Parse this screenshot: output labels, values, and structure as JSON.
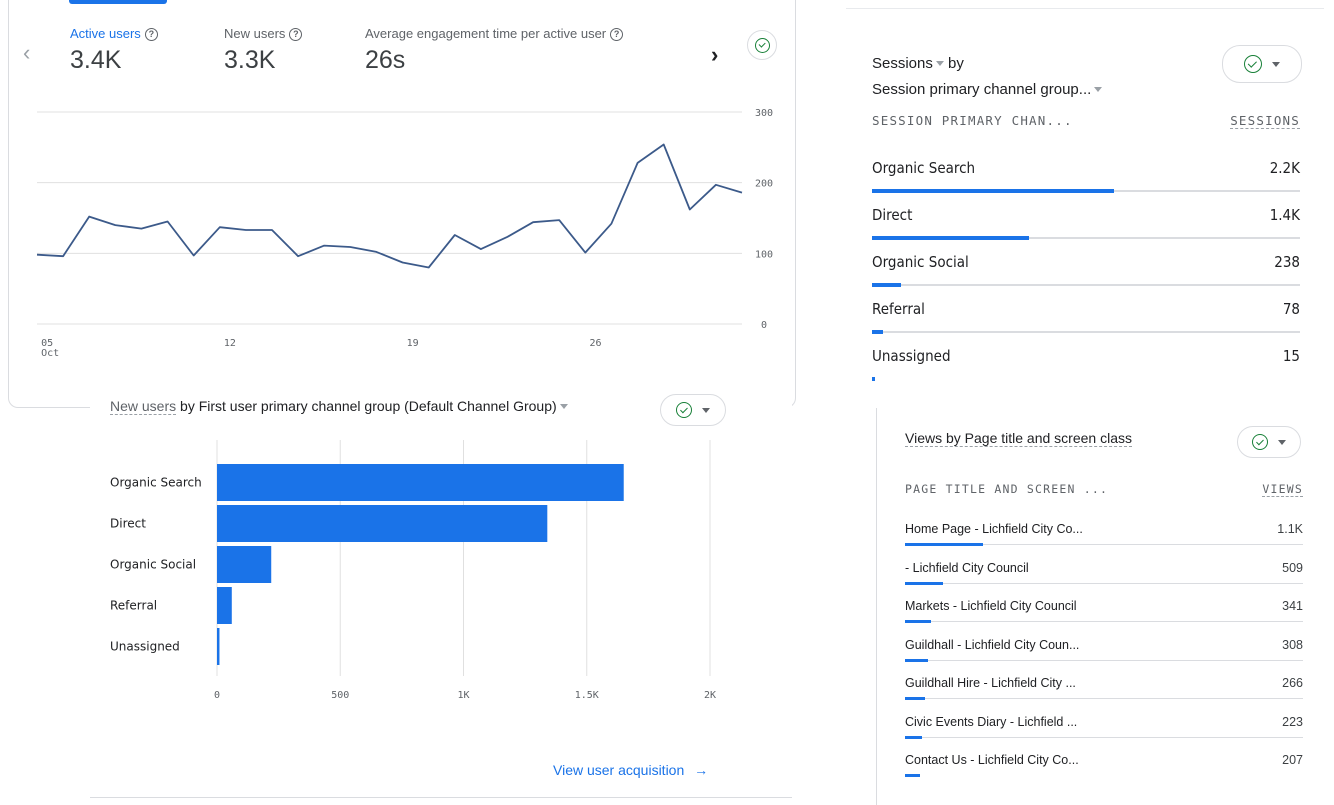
{
  "trend_card": {
    "metrics": [
      {
        "label": "Active users",
        "value": "3.4K",
        "active": true
      },
      {
        "label": "New users",
        "value": "3.3K",
        "active": false
      },
      {
        "label": "Average engagement time per active user",
        "value": "26s",
        "active": false
      }
    ],
    "prev_glyph": "‹",
    "next_glyph": "›"
  },
  "sessions_card": {
    "title_metric": "Sessions",
    "title_by": "by",
    "title_dimension": "Session primary channel group...",
    "col_dimension": "SESSION PRIMARY CHAN...",
    "col_metric": "SESSIONS",
    "rows": [
      {
        "label": "Organic Search",
        "value": "2.2K",
        "fraction": 1.0
      },
      {
        "label": "Direct",
        "value": "1.4K",
        "fraction": 0.65
      },
      {
        "label": "Organic Social",
        "value": "238",
        "fraction": 0.12
      },
      {
        "label": "Referral",
        "value": "78",
        "fraction": 0.045
      },
      {
        "label": "Unassigned",
        "value": "15",
        "fraction": 0.01
      }
    ]
  },
  "newusers_card": {
    "title_metric": "New users",
    "title_rest": " by First user primary channel group (Default Channel Group)",
    "link_label": "View user acquisition",
    "link_arrow": "→"
  },
  "views_card": {
    "title": "Views by Page title and screen class",
    "col_dimension": "PAGE TITLE AND SCREEN ...",
    "col_metric": "VIEWS",
    "rows": [
      {
        "label": "Home Page - Lichfield City Co...",
        "value": "1.1K",
        "fraction": 0.27
      },
      {
        "label": "- Lichfield City Council",
        "value": "509",
        "fraction": 0.13
      },
      {
        "label": "Markets - Lichfield City Council",
        "value": "341",
        "fraction": 0.09
      },
      {
        "label": "Guildhall - Lichfield City Coun...",
        "value": "308",
        "fraction": 0.08
      },
      {
        "label": "Guildhall Hire - Lichfield City ...",
        "value": "266",
        "fraction": 0.07
      },
      {
        "label": "Civic Events Diary - Lichfield ...",
        "value": "223",
        "fraction": 0.06
      },
      {
        "label": "Contact Us - Lichfield City Co...",
        "value": "207",
        "fraction": 0.05
      }
    ]
  },
  "colors": {
    "accent": "#1a73e8",
    "line": "#3c5a8a",
    "check": "#188038"
  },
  "chart_data": [
    {
      "type": "line",
      "x": [
        "Oct 4",
        "Oct 5",
        "Oct 6",
        "Oct 7",
        "Oct 8",
        "Oct 9",
        "Oct 10",
        "Oct 11",
        "Oct 12",
        "Oct 13",
        "Oct 14",
        "Oct 15",
        "Oct 16",
        "Oct 17",
        "Oct 18",
        "Oct 19",
        "Oct 20",
        "Oct 21",
        "Oct 22",
        "Oct 23",
        "Oct 24",
        "Oct 25",
        "Oct 26",
        "Oct 27",
        "Oct 28",
        "Oct 29",
        "Oct 30",
        "Oct 31"
      ],
      "series": [
        {
          "values": [
            98,
            96,
            152,
            140,
            135,
            145,
            97,
            137,
            133,
            133,
            96,
            111,
            109,
            102,
            87,
            80,
            126,
            106,
            123,
            144,
            147,
            101,
            142,
            228,
            254,
            162,
            197,
            186
          ]
        }
      ],
      "xticks": [
        {
          "day": "05",
          "month": "Oct",
          "index": 1
        },
        {
          "day": "12",
          "month": "",
          "index": 8
        },
        {
          "day": "19",
          "month": "",
          "index": 15
        },
        {
          "day": "26",
          "month": "",
          "index": 22
        }
      ],
      "yticks": [
        "0",
        "100",
        "200",
        "300"
      ],
      "ylim": [
        0,
        300
      ],
      "grid": true
    },
    {
      "type": "bar",
      "orientation": "horizontal",
      "categories": [
        "Organic Search",
        "Direct",
        "Organic Social",
        "Referral",
        "Unassigned"
      ],
      "values": [
        1650,
        1340,
        220,
        60,
        10
      ],
      "xticks": [
        "0",
        "500",
        "1K",
        "1.5K",
        "2K"
      ],
      "xlim": [
        0,
        2000
      ],
      "grid": true
    }
  ]
}
